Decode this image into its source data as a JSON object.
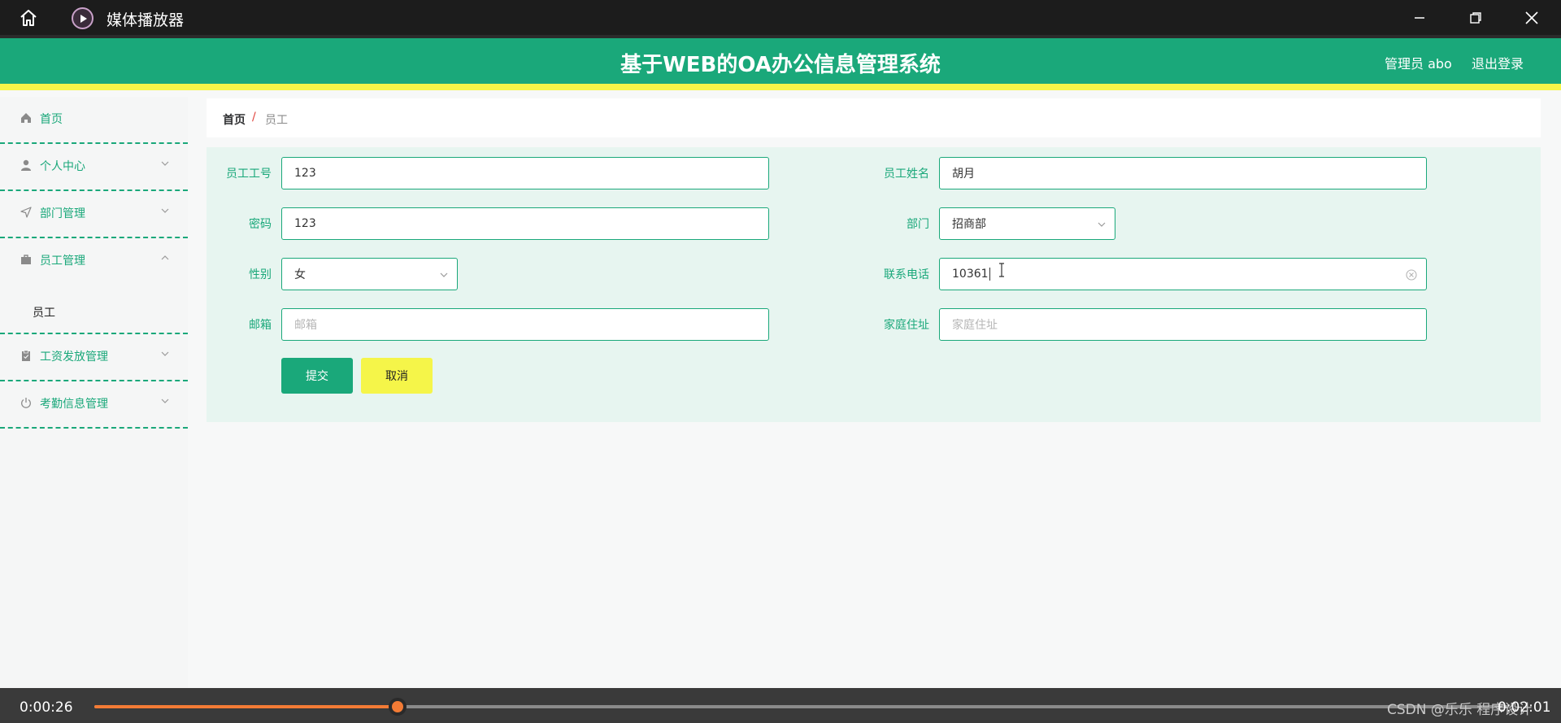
{
  "titlebar": {
    "app_name": "媒体播放器"
  },
  "header": {
    "title": "基于WEB的OA办公信息管理系统",
    "user": "管理员 abo",
    "logout": "退出登录"
  },
  "sidebar": {
    "items": [
      {
        "label": "首页"
      },
      {
        "label": "个人中心"
      },
      {
        "label": "部门管理"
      },
      {
        "label": "员工管理"
      },
      {
        "label": "工资发放管理"
      },
      {
        "label": "考勤信息管理"
      }
    ],
    "sub_item": "员工"
  },
  "breadcrumb": {
    "home": "首页",
    "separator": "/",
    "current": "员工"
  },
  "form": {
    "emp_no": {
      "label": "员工工号",
      "value": "123"
    },
    "emp_name": {
      "label": "员工姓名",
      "value": "胡月"
    },
    "password": {
      "label": "密码",
      "value": "123"
    },
    "dept": {
      "label": "部门",
      "value": "招商部"
    },
    "gender": {
      "label": "性别",
      "value": "女"
    },
    "phone": {
      "label": "联系电话",
      "value": "10361"
    },
    "email": {
      "label": "邮箱",
      "placeholder": "邮箱"
    },
    "address": {
      "label": "家庭住址",
      "placeholder": "家庭住址"
    },
    "submit": "提交",
    "cancel": "取消"
  },
  "player": {
    "elapsed": "0:00:26",
    "total": "0:02:01",
    "progress": 0.2146,
    "watermark": "CSDN @乐乐 程序设计"
  },
  "colors": {
    "primary": "#1aa87a",
    "accent_yellow": "#f5f549",
    "progress": "#f37b35"
  }
}
